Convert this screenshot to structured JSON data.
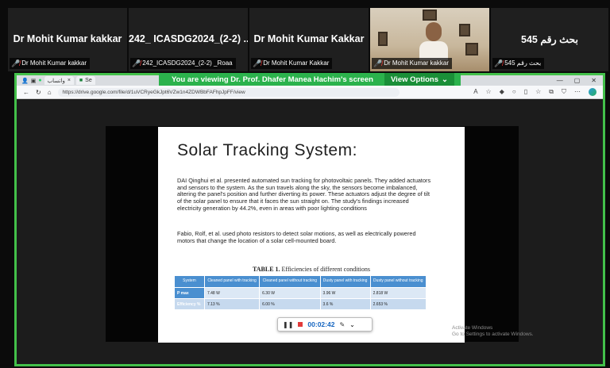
{
  "participants": [
    {
      "display_name": "Dr Mohit Kumar kakkar",
      "tag": "Dr Mohit Kumar kakkar"
    },
    {
      "display_name": "242_ ICASDG2024_(2-2) ...",
      "tag": "242_ICASDG2024_(2-2) _Roaa"
    },
    {
      "display_name": "Dr Mohit Kumar Kakkar",
      "tag": "Dr Mohit Kumar Kakkar"
    },
    {
      "display_name": "",
      "tag": "Dr Mohit Kumar kakkar"
    },
    {
      "display_name": "بحث رقم 545",
      "tag": "بحث رقم 545"
    }
  ],
  "share_banner": {
    "text": "You are viewing  Dr. Prof. Dhafer Manea Hachim's screen",
    "view_options": "View Options"
  },
  "browser": {
    "tab1": "واتساب",
    "tab2": "Se",
    "url": "https://drive.google.com/file/d/1uVCRyeGkJpt6VZw1n4ZDWBbFAFhpJpFF/view"
  },
  "slide": {
    "title": "Solar Tracking System:",
    "para1": "DAI Qinghui et al. presented automated sun tracking for photovoltaic panels. They added actuators and sensors to the system. As the sun travels along the sky, the sensors become imbalanced, altering the panel's position and further diverting its power. These actuators adjust the degree of tilt of the solar panel to ensure that it faces the sun straight on. The study's findings increased electricity generation by 44.2%, even in areas with poor lighting conditions",
    "para2": "Fabio, Rolf, et al. used photo resistors to detect solar motions, as well as electrically powered motors that change the location of a solar cell-mounted board.",
    "table_caption_bold": "TABLE 1.",
    "table_caption_rest": " Efficiencies of different conditions",
    "table": {
      "headers": [
        "System",
        "Cleaned panel with tracking",
        "Cleaned panel without tracking",
        "Dusty panel with tracking",
        "Dusty panel without tracking"
      ],
      "rows": [
        [
          "P max",
          "7.48 W",
          "6.30 W",
          "3.96 W",
          "2.818 W"
        ],
        [
          "Efficiency %",
          "7.13 %",
          "6.00 %",
          "3.6 %",
          "2.653 %"
        ]
      ]
    }
  },
  "player": {
    "time": "00:02:42"
  },
  "watermark": {
    "line1": "Activate Windows",
    "line2": "Go to Settings to activate Windows."
  }
}
